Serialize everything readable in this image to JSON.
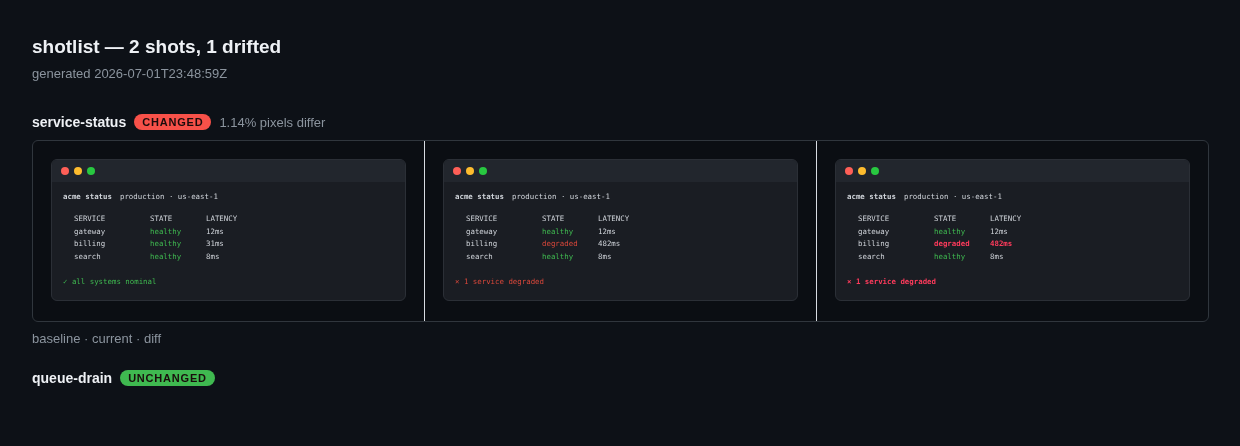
{
  "title": "shotlist — 2 shots, 1 drifted",
  "generated": "generated 2026-07-01T23:48:59Z",
  "shots": [
    {
      "name": "service-status",
      "changed": true,
      "badge": "CHANGED",
      "summary": "1.14% pixels differ",
      "caption": "baseline · current · diff",
      "panels": [
        {
          "app": "acme status",
          "env": "production · us-east-1",
          "columns": [
            "SERVICE",
            "STATE",
            "LATENCY"
          ],
          "rows": [
            {
              "service": "gateway",
              "state": "healthy",
              "degraded": false,
              "changed": false,
              "latency": "12ms"
            },
            {
              "service": "billing",
              "state": "healthy",
              "degraded": false,
              "changed": false,
              "latency": "31ms"
            },
            {
              "service": "search",
              "state": "healthy",
              "degraded": false,
              "changed": false,
              "latency": "8ms"
            }
          ],
          "footer": {
            "text": "✓ all systems nominal",
            "degraded": false,
            "changed": false
          }
        },
        {
          "app": "acme status",
          "env": "production · us-east-1",
          "columns": [
            "SERVICE",
            "STATE",
            "LATENCY"
          ],
          "rows": [
            {
              "service": "gateway",
              "state": "healthy",
              "degraded": false,
              "changed": false,
              "latency": "12ms"
            },
            {
              "service": "billing",
              "state": "degraded",
              "degraded": true,
              "changed": false,
              "latency": "482ms"
            },
            {
              "service": "search",
              "state": "healthy",
              "degraded": false,
              "changed": false,
              "latency": "8ms"
            }
          ],
          "footer": {
            "text": "× 1 service degraded",
            "degraded": true,
            "changed": false
          }
        },
        {
          "app": "acme status",
          "env": "production · us-east-1",
          "columns": [
            "SERVICE",
            "STATE",
            "LATENCY"
          ],
          "rows": [
            {
              "service": "gateway",
              "state": "healthy",
              "degraded": false,
              "changed": false,
              "latency": "12ms"
            },
            {
              "service": "billing",
              "state": "degraded",
              "degraded": true,
              "changed": true,
              "latency": "482ms"
            },
            {
              "service": "search",
              "state": "healthy",
              "degraded": false,
              "changed": false,
              "latency": "8ms"
            }
          ],
          "footer": {
            "text": "× 1 service degraded",
            "degraded": true,
            "changed": true
          }
        }
      ]
    },
    {
      "name": "queue-drain",
      "changed": false,
      "badge": "UNCHANGED"
    }
  ]
}
